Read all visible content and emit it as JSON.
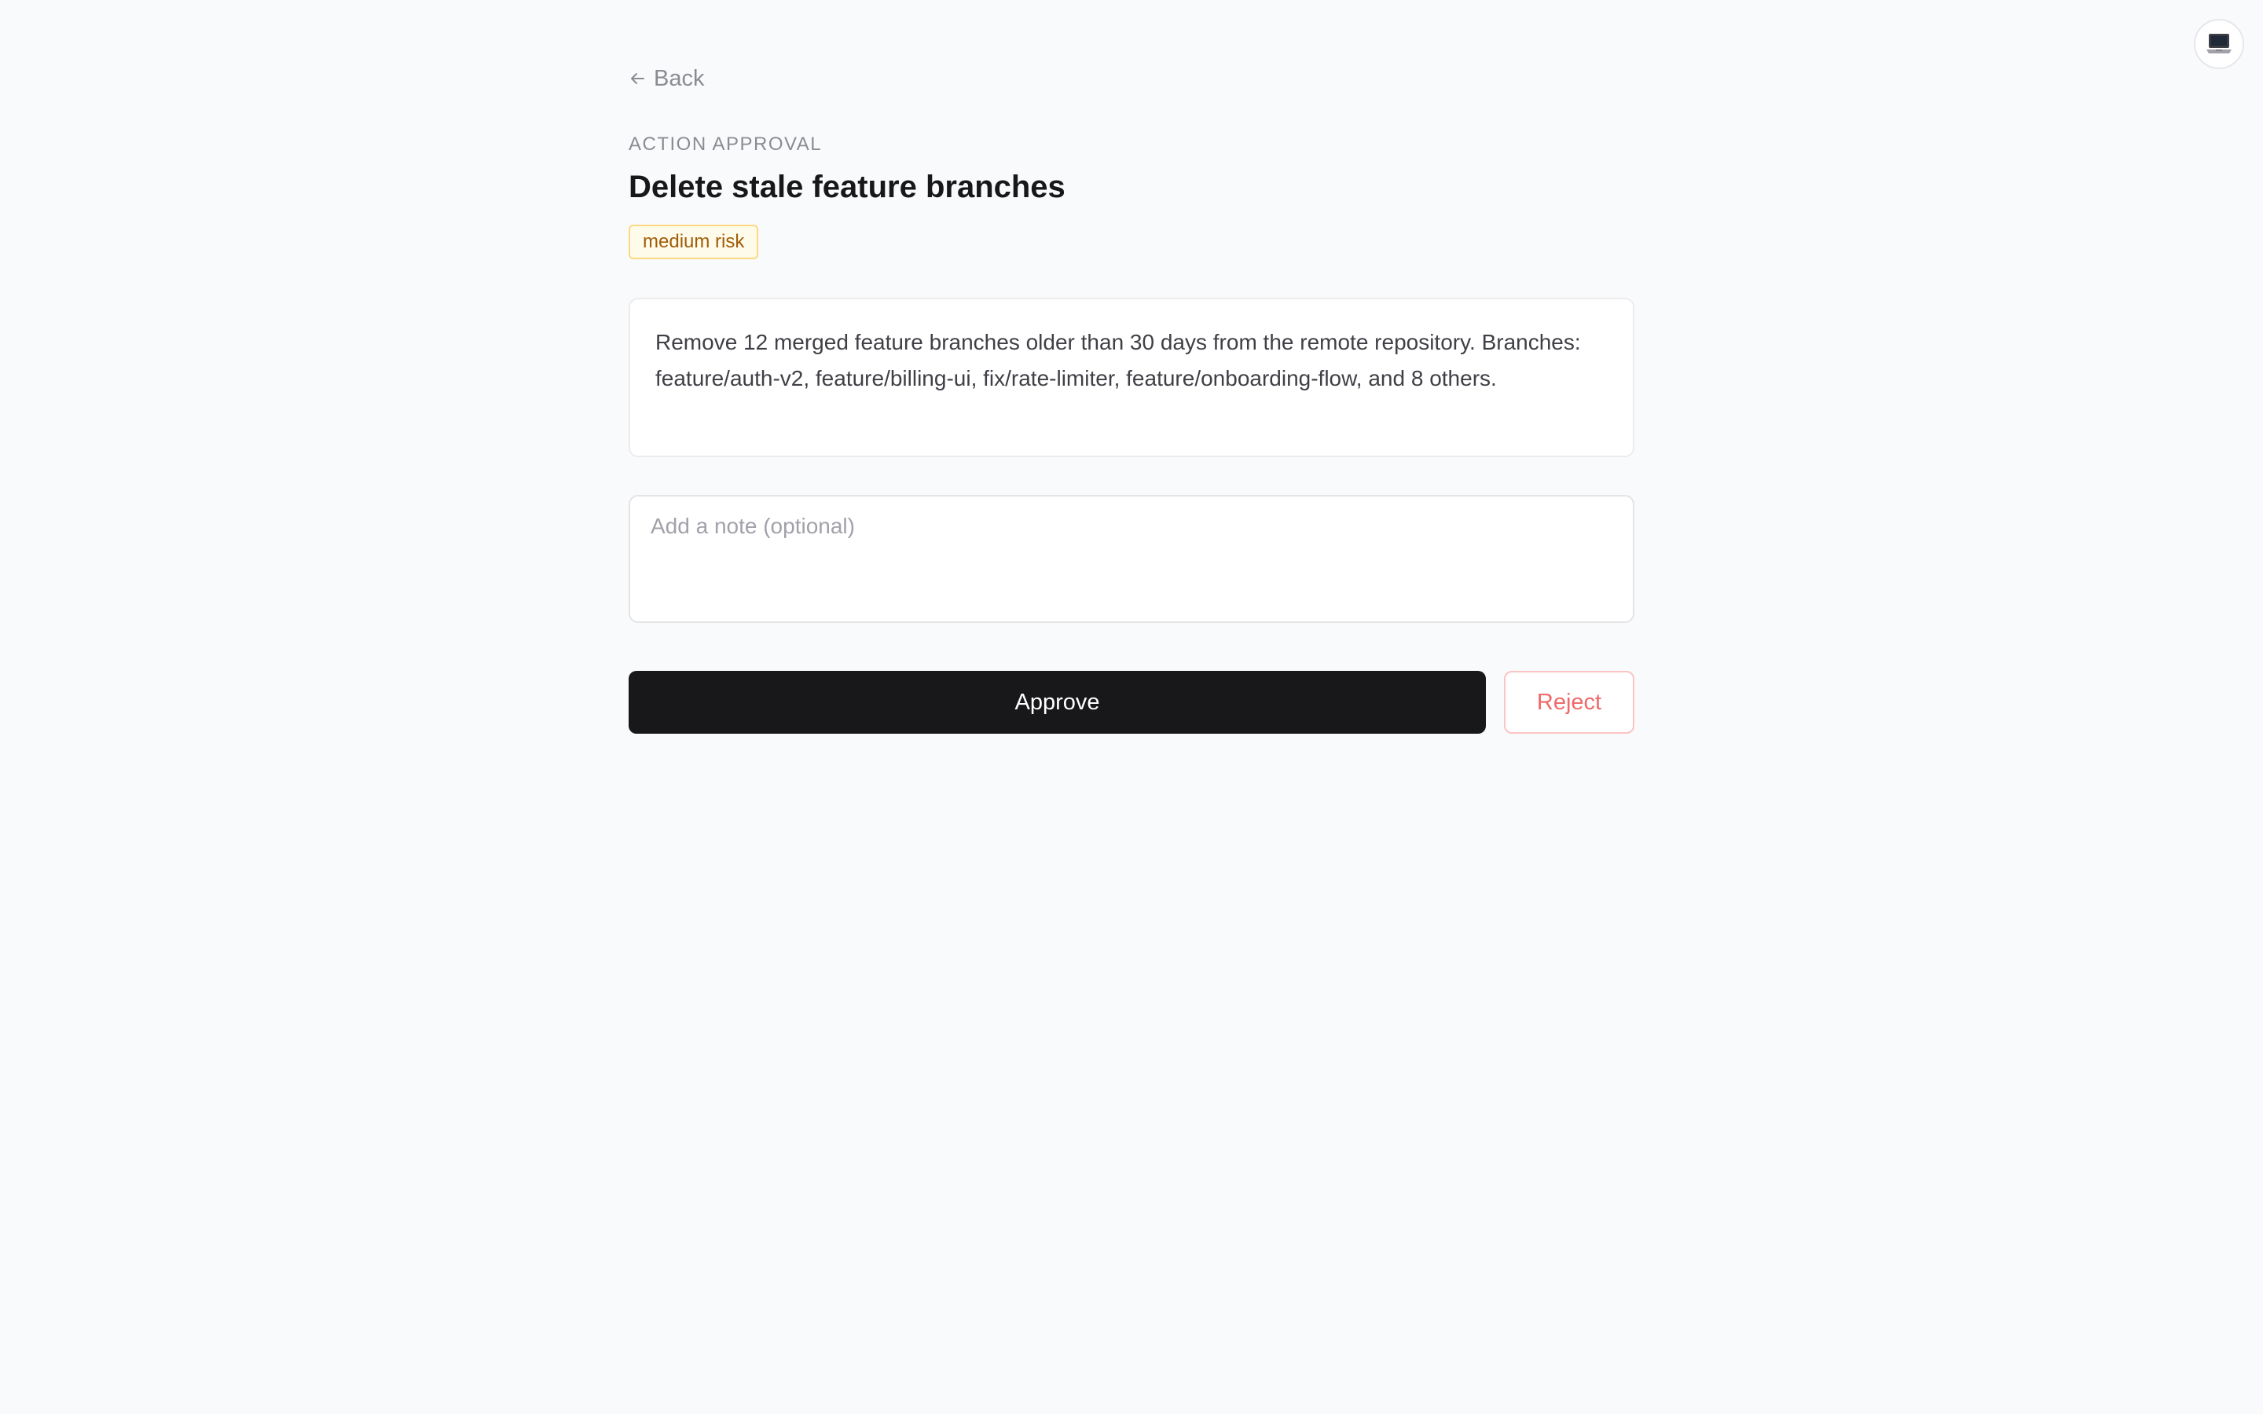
{
  "header": {
    "avatar_icon": "laptop-icon"
  },
  "nav": {
    "back_label": "Back",
    "back_icon": "arrow-left-icon"
  },
  "approval": {
    "eyebrow": "ACTION APPROVAL",
    "title": "Delete stale feature branches",
    "risk_badge": "medium risk",
    "description": "Remove 12 merged feature branches older than 30 days from the remote repository. Branches: feature/auth-v2, feature/billing-ui, fix/rate-limiter, feature/onboarding-flow, and 8 others."
  },
  "note": {
    "value": "",
    "placeholder": "Add a note (optional)"
  },
  "actions": {
    "approve_label": "Approve",
    "reject_label": "Reject"
  },
  "colors": {
    "background": "#f9fafb",
    "primary": "#18181b",
    "danger": "#ef6a6a",
    "warning_bg": "#fffbeb",
    "warning_text": "#a15c07"
  }
}
